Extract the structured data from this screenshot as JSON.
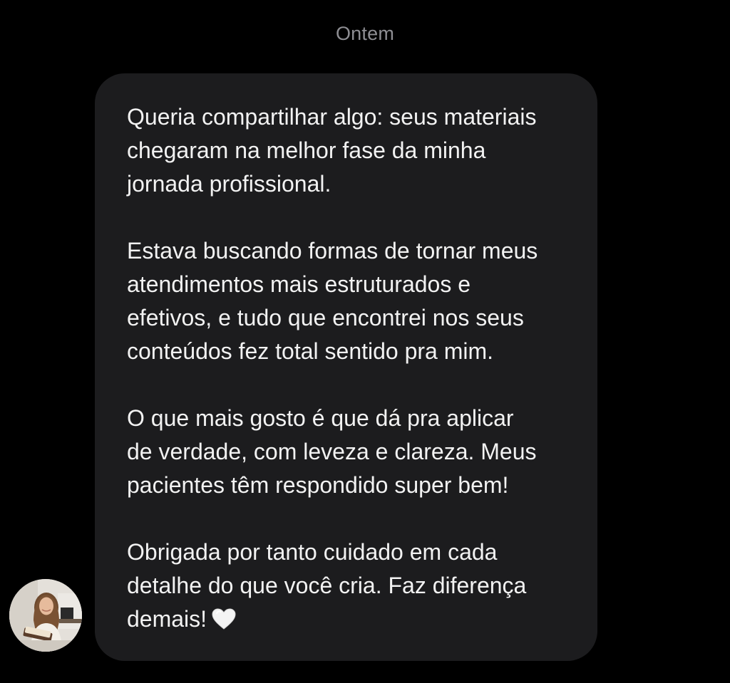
{
  "conversation": {
    "date_label": "Ontem"
  },
  "message": {
    "paragraphs": [
      {
        "lines": [
          "Queria compartilhar algo: seus materiais",
          "chegaram na melhor fase da minha",
          "jornada profissional."
        ]
      },
      {
        "lines": [
          "Estava buscando formas de tornar meus",
          "atendimentos mais estruturados e",
          "efetivos, e tudo que encontrei nos seus",
          "conteúdos fez total sentido pra mim."
        ]
      },
      {
        "lines": [
          "O que mais gosto é que dá pra aplicar",
          "de verdade, com leveza e clareza. Meus",
          "pacientes têm respondido super bem!"
        ]
      },
      {
        "lines": [
          "Obrigada por tanto cuidado em cada",
          "detalhe do que você cria. Faz diferença",
          "demais!"
        ],
        "trailing_icon": "white-heart-icon"
      }
    ]
  },
  "sender": {
    "avatar_icon": "profile-photo-avatar"
  },
  "colors": {
    "background": "#000000",
    "bubble": "#1c1c1e",
    "text": "#f2f2f2",
    "date_text": "#8e8e93"
  }
}
